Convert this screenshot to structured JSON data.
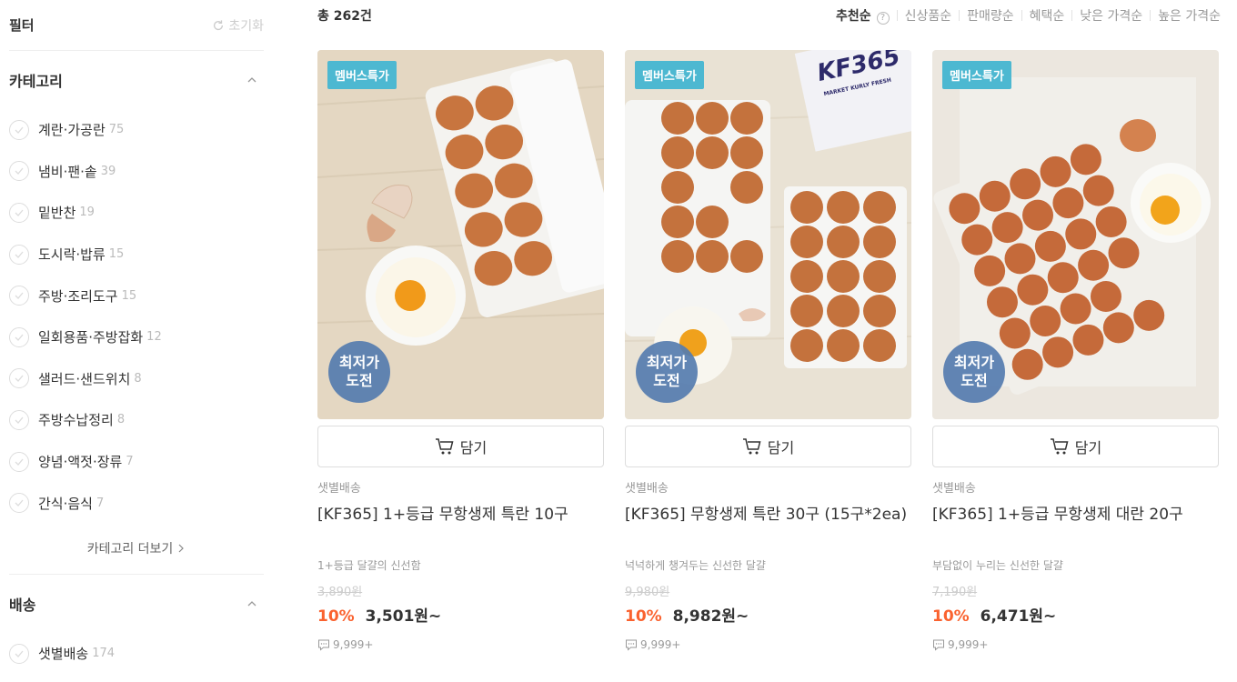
{
  "sidebar": {
    "title": "필터",
    "reset_label": "초기화",
    "category_section_title": "카테고리",
    "categories": [
      {
        "label": "계란·가공란",
        "count": "75"
      },
      {
        "label": "냄비·팬·솥",
        "count": "39"
      },
      {
        "label": "밑반찬",
        "count": "19"
      },
      {
        "label": "도시락·밥류",
        "count": "15"
      },
      {
        "label": "주방·조리도구",
        "count": "15"
      },
      {
        "label": "일회용품·주방잡화",
        "count": "12"
      },
      {
        "label": "샐러드·샌드위치",
        "count": "8"
      },
      {
        "label": "주방수납정리",
        "count": "8"
      },
      {
        "label": "양념·액젓·장류",
        "count": "7"
      },
      {
        "label": "간식·음식",
        "count": "7"
      }
    ],
    "more_label": "카테고리 더보기",
    "delivery_section_title": "배송",
    "delivery_options": [
      {
        "label": "샛별배송",
        "count": "174"
      }
    ]
  },
  "main": {
    "total": "총 262건",
    "sort_options": [
      "추천순",
      "신상품순",
      "판매량순",
      "혜택순",
      "낮은 가격순",
      "높은 가격순"
    ],
    "active_sort": "추천순",
    "help_glyph": "?"
  },
  "products": [
    {
      "badge": "멤버스특가",
      "lowest_badge_line1": "최저가",
      "lowest_badge_line2": "도전",
      "cart_label": "담기",
      "delivery": "샛별배송",
      "name": "[KF365] 1+등급 무항생제 특란 10구",
      "description": "1+등급 달걀의 신선함",
      "original_price": "3,890원",
      "discount": "10%",
      "price": "3,501원~",
      "reviews": "9,999+"
    },
    {
      "badge": "멤버스특가",
      "lowest_badge_line1": "최저가",
      "lowest_badge_line2": "도전",
      "cart_label": "담기",
      "delivery": "샛별배송",
      "name": "[KF365] 무항생제 특란 30구 (15구*2ea)",
      "description": "넉넉하게 챙겨두는 신선한 달걀",
      "original_price": "9,980원",
      "discount": "10%",
      "price": "8,982원~",
      "reviews": "9,999+",
      "box_text": "KF365",
      "box_subtext": "MARKET KURLY FRESH"
    },
    {
      "badge": "멤버스특가",
      "lowest_badge_line1": "최저가",
      "lowest_badge_line2": "도전",
      "cart_label": "담기",
      "delivery": "샛별배송",
      "name": "[KF365] 1+등급 무항생제 대란 20구",
      "description": "부담없이 누리는 신선한 달걀",
      "original_price": "7,190원",
      "discount": "10%",
      "price": "6,471원~",
      "reviews": "9,999+"
    }
  ],
  "colors": {
    "accent_discount": "#fa622f",
    "badge_member": "#4db8d1",
    "badge_lowest": "#557caf"
  },
  "icons": {
    "reset": "refresh-icon",
    "chevron_up": "chevron-up-icon",
    "check": "check-circle-icon",
    "chevron_right": "chevron-right-icon",
    "cart": "cart-icon",
    "review": "speech-bubble-icon"
  }
}
